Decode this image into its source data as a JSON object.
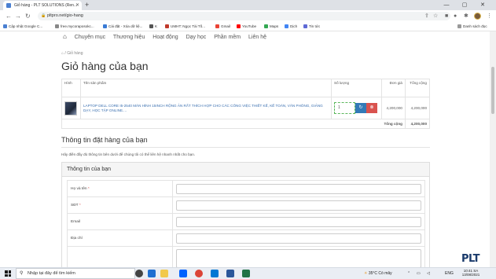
{
  "browser": {
    "tab_title": "Giỏ hàng - PLT SOLUTIONS (Ren...",
    "url": "pltpro.net/gio-hang",
    "bookmarks": [
      "Cập nhật Google C...",
      "free.mycoraposokc...",
      "Cài đặt - Xóa dữ liệ...",
      "K",
      "UMHT: Ngọc Tài Tố...",
      "Gmail",
      "YouTube",
      "Maps",
      "Dịch",
      "Tin tức"
    ],
    "reading_list": "Danh sách đọc"
  },
  "nav": {
    "items": [
      "Chuyên mục",
      "Thương hiệu",
      "Hoạt động",
      "Dạy học",
      "Phần mềm",
      "Liên hệ"
    ]
  },
  "breadcrumb": {
    "current": "Giỏ hàng"
  },
  "page_title": "Giỏ hàng của bạn",
  "cart": {
    "headers": {
      "image": "Hình",
      "product": "Tên sản phẩm",
      "qty": "Số lượng",
      "price": "Đơn giá",
      "total": "Tổng cộng"
    },
    "items": [
      {
        "name": "LAPTOP DELL CORE I5-2540 MÀN HÌNH 15INCH RỘNG ẢN RẤT THÍCH HỢP CHO CÁC CÔNG VIỆC THIẾT KẾ, KẾ TOÁN, VĂN PHÒNG, GIẢNG DẠY, HỌC TẬP ONLINE....",
        "qty": "1",
        "price": "4,200,000",
        "total": "4,200,000"
      }
    ],
    "grand_total_label": "Tổng cộng",
    "grand_total": "4,200,000"
  },
  "order_info": {
    "title": "Thông tin đặt hàng của bạn",
    "description": "Hãy điền đầy đủ thông tin bên dưới để chúng tôi có thể liên hệ nhanh nhất cho bạn.",
    "panel_title": "Thông tin của bạn",
    "fields": [
      {
        "label": "Họ và tên",
        "required": "*"
      },
      {
        "label": "SĐT",
        "required": "*"
      },
      {
        "label": "Email",
        "required": ""
      },
      {
        "label": "Địa chỉ",
        "required": ""
      },
      {
        "label": "",
        "required": ""
      }
    ]
  },
  "taskbar": {
    "search_placeholder": "Nhập tại đây để tìm kiếm",
    "weather": "35°C Có mây",
    "lang": "ENG",
    "time": "10:41 SA",
    "date": "13/08/2021"
  },
  "watermark": "PLT",
  "colors": {
    "link": "#3a6fb0",
    "refresh": "#337ab7",
    "remove": "#d9534f",
    "required": "#d9534f"
  }
}
